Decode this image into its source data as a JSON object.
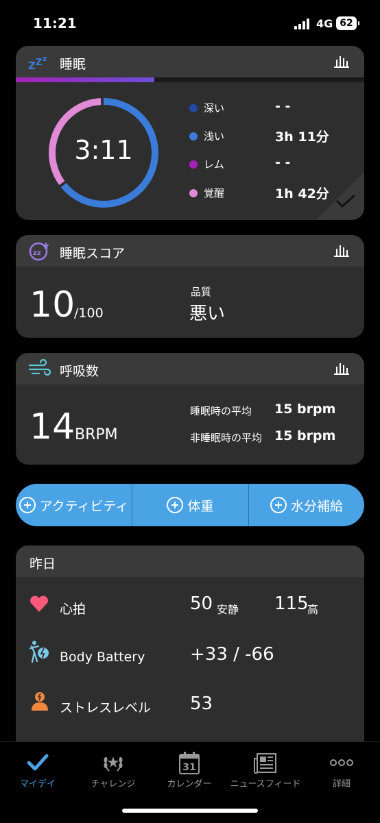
{
  "status_bar": {
    "time": "11:21",
    "network": "4G",
    "battery": "62"
  },
  "sleep": {
    "title": "睡眠",
    "duration": "3:11",
    "stages": [
      {
        "label": "深い",
        "value": "- -",
        "color": "#1f4aa8"
      },
      {
        "label": "浅い",
        "value": "3h 11分",
        "color": "#3b7bd9"
      },
      {
        "label": "レム",
        "value": "- -",
        "color": "#a323b8"
      },
      {
        "label": "覚醒",
        "value": "1h 42分",
        "color": "#e18ad6"
      }
    ],
    "light_fraction": 0.65,
    "awake_fraction": 0.35
  },
  "sleep_score": {
    "title": "睡眠スコア",
    "score": "10",
    "max": "/100",
    "quality_label": "品質",
    "quality": "悪い"
  },
  "respiration": {
    "title": "呼吸数",
    "value": "14",
    "unit": "BRPM",
    "rows": [
      {
        "label": "睡眠時の平均",
        "value": "15 brpm"
      },
      {
        "label": "非睡眠時の平均",
        "value": "15 brpm"
      }
    ]
  },
  "actions": [
    {
      "label": "アクティビティ"
    },
    {
      "label": "体重"
    },
    {
      "label": "水分補給"
    }
  ],
  "yesterday": {
    "title": "昨日",
    "heart_rate": {
      "label": "心拍",
      "resting_value": "50",
      "resting_label": "安静",
      "high_value": "115",
      "high_label": "高"
    },
    "body_battery": {
      "label": "Body Battery",
      "value": "+33 / -66"
    },
    "stress": {
      "label": "ストレスレベル",
      "value": "53"
    }
  },
  "tabs": [
    {
      "label": "マイデイ",
      "icon": "check-icon",
      "active": true
    },
    {
      "label": "チャレンジ",
      "icon": "laurel-icon"
    },
    {
      "label": "カレンダー",
      "icon": "calendar-icon",
      "day": "31"
    },
    {
      "label": "ニュースフィード",
      "icon": "newsfeed-icon"
    },
    {
      "label": "詳細",
      "icon": "more-dots-icon"
    }
  ],
  "colors": {
    "accent": "#4aa3e4",
    "card": "#2e2e2e",
    "header": "#3a3a3a"
  }
}
